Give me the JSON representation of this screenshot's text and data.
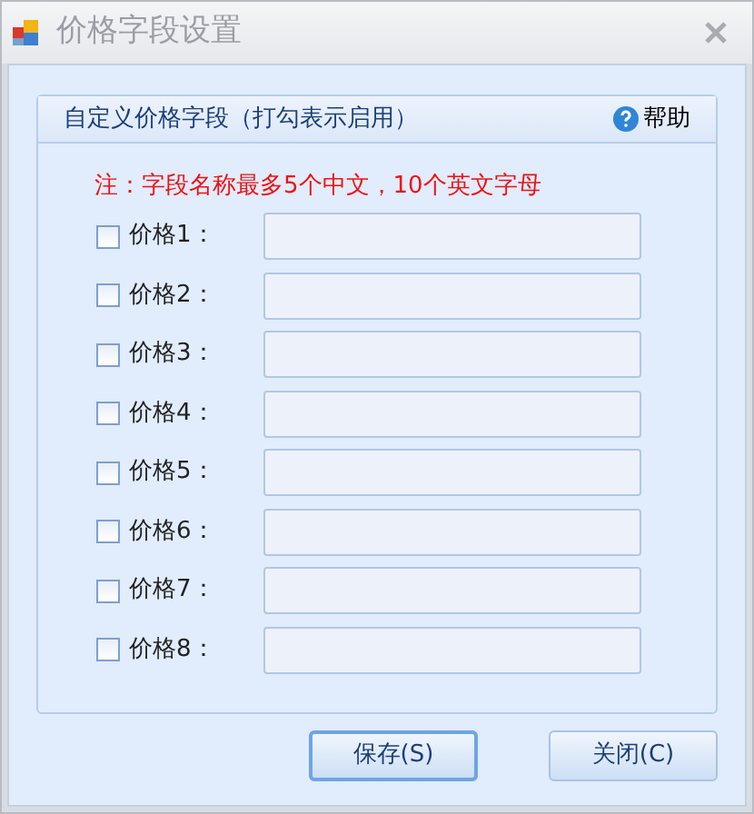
{
  "window": {
    "title": "价格字段设置"
  },
  "panel": {
    "title": "自定义价格字段（打勾表示启用）",
    "help": "帮助",
    "note": "注：字段名称最多5个中文，10个英文字母"
  },
  "fields": [
    {
      "label": "价格1：",
      "checked": false
    },
    {
      "label": "价格2：",
      "checked": false
    },
    {
      "label": "价格3：",
      "checked": false
    },
    {
      "label": "价格4：",
      "checked": false
    },
    {
      "label": "价格5：",
      "checked": false
    },
    {
      "label": "价格6：",
      "checked": false
    },
    {
      "label": "价格7：",
      "checked": false
    },
    {
      "label": "价格8：",
      "checked": false
    }
  ],
  "buttons": [
    {
      "label": "保存(S)",
      "selected": true
    },
    {
      "label": "关闭(C)",
      "selected": false
    }
  ]
}
